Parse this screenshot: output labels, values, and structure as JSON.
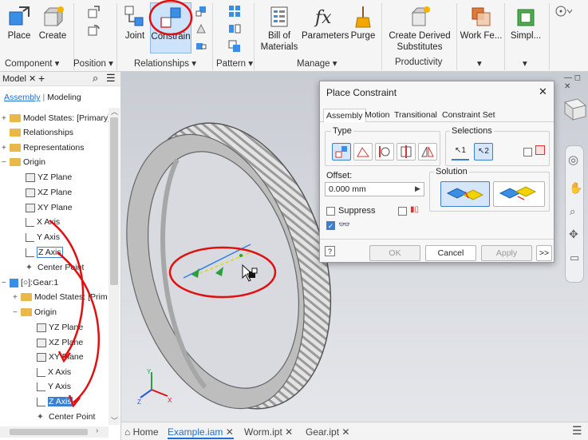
{
  "ribbon": {
    "buttons": {
      "place": "Place",
      "create": "Create",
      "joint": "Joint",
      "constrain": "Constrain",
      "bill_of_materials_1": "Bill of",
      "bill_of_materials_2": "Materials",
      "parameters": "Parameters",
      "purge": "Purge",
      "create_derived_1": "Create Derived",
      "create_derived_2": "Substitutes",
      "work_features": "Work Fe...",
      "simplify": "Simpl..."
    },
    "panels": {
      "component": "Component",
      "position": "Position",
      "relationships": "Relationships",
      "pattern": "Pattern",
      "manage": "Manage",
      "productivity": "Productivity"
    }
  },
  "browser": {
    "tab_model": "Model",
    "mode_assembly": "Assembly",
    "mode_modeling": "Modeling",
    "items": [
      "Model States: [Primary]",
      "Relationships",
      "Representations",
      "Origin",
      "YZ Plane",
      "XZ Plane",
      "XY Plane",
      "X Axis",
      "Y Axis",
      "Z Axis",
      "Center Point",
      "[○]:Gear:1",
      "Model States: [Prim",
      "Origin",
      "YZ Plane",
      "XZ Plane",
      "XY Plane",
      "X Axis",
      "Y Axis",
      "Z Axis",
      "Center Point"
    ]
  },
  "doc_tabs": {
    "home": "Home",
    "example": "Example.iam",
    "worm": "Worm.ipt",
    "gear": "Gear.ipt"
  },
  "dialog": {
    "title": "Place Constraint",
    "tabs": [
      "Assembly",
      "Motion",
      "Transitional",
      "Constraint Set"
    ],
    "type_label": "Type",
    "selections_label": "Selections",
    "sel1": "1",
    "sel2": "2",
    "offset_label": "Offset:",
    "offset_value": "0.000 mm",
    "solution_label": "Solution",
    "suppress_label": "Suppress",
    "ok": "OK",
    "cancel": "Cancel",
    "apply": "Apply",
    "more": ">>"
  },
  "triad": {
    "x": "X",
    "y": "Y",
    "z": "Z"
  },
  "colors": {
    "accent": "#1f6fd1",
    "annotation_red": "#e01010",
    "folder": "#e8b84a",
    "highlight": "#cde3fb"
  }
}
